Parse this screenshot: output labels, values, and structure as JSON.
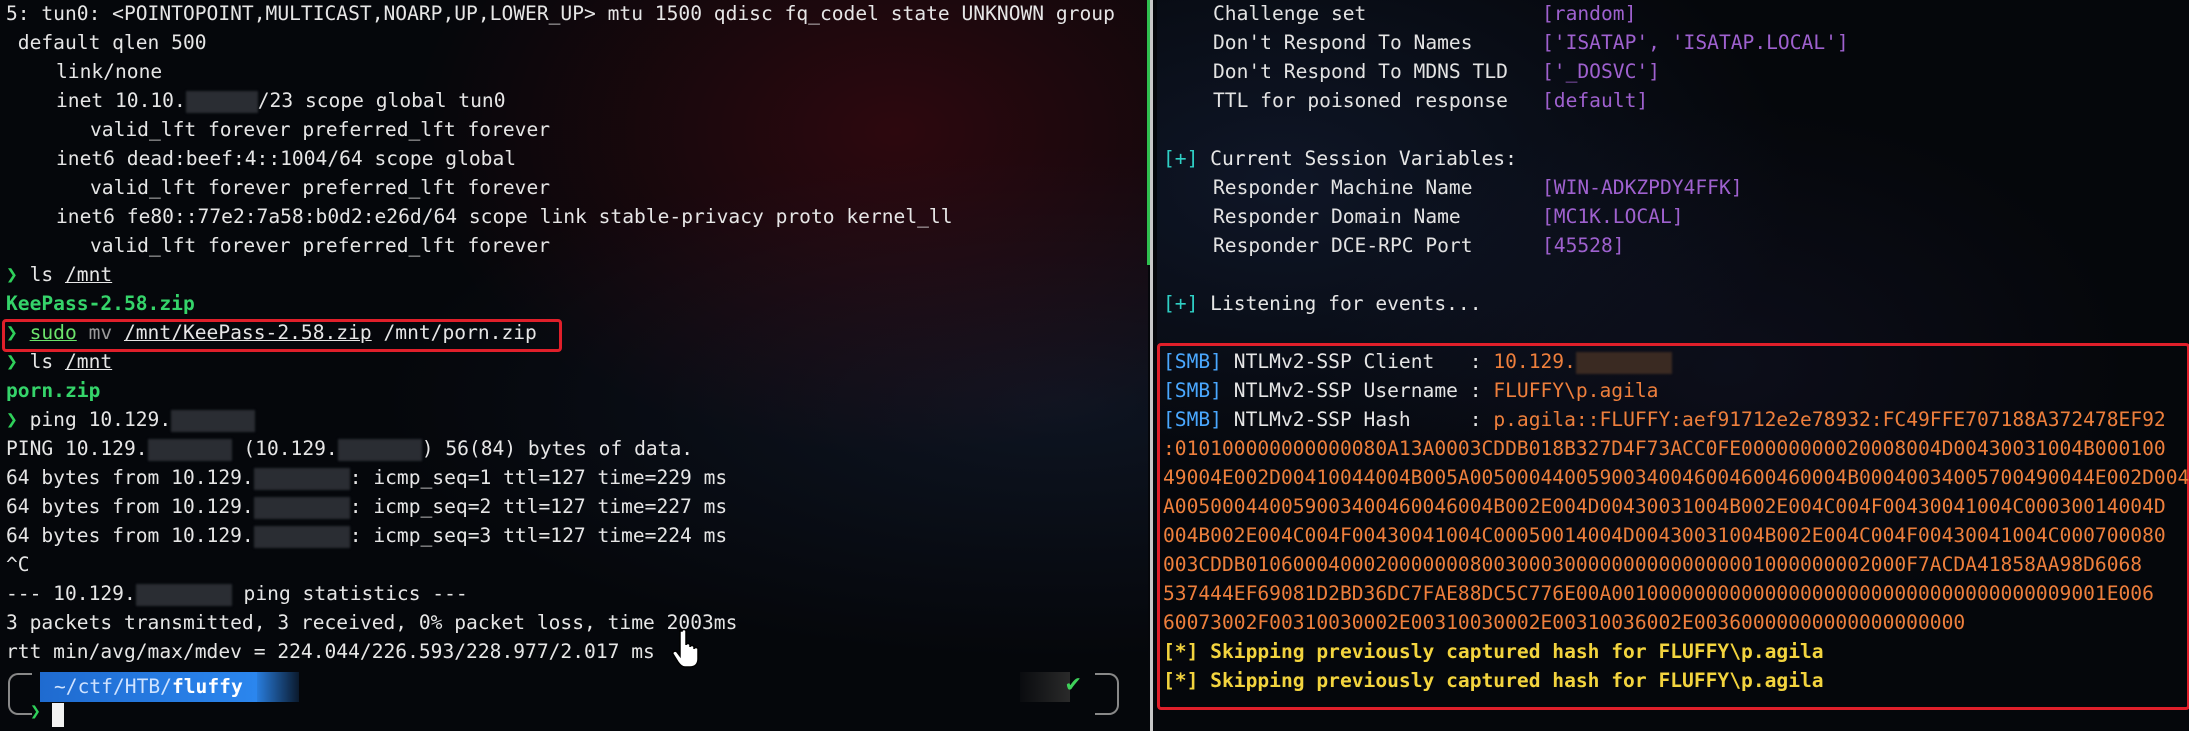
{
  "left_terminal": {
    "lines": {
      "l1": "5: tun0: <POINTOPOINT,MULTICAST,NOARP,UP,LOWER_UP> mtu 1500 qdisc fq_codel state UNKNOWN group",
      "l2": " default qlen 500",
      "l3": "link/none",
      "l4a": "inet 10.10.",
      "l4b": "/23 scope global tun0",
      "l5": "valid_lft forever preferred_lft forever",
      "l6": "inet6 dead:beef:4::1004/64 scope global",
      "l7": "valid_lft forever preferred_lft forever",
      "l8": "inet6 fe80::77e2:7a58:b0d2:e26d/64 scope link stable-privacy proto kernel_ll",
      "l9": "valid_lft forever preferred_lft forever"
    },
    "prompt_symbol": "❯",
    "cmd_ls1": {
      "cmd": "ls",
      "arg": "/mnt"
    },
    "out_ls1": "KeePass-2.58.zip",
    "cmd_mv": {
      "sudo": "sudo",
      "mv": "mv",
      "src": "/mnt/KeePass-2.58.zip",
      "dst": "/mnt/porn.zip"
    },
    "cmd_ls2": {
      "cmd": "ls",
      "arg": "/mnt"
    },
    "out_ls2": "porn.zip",
    "cmd_ping": {
      "cmd": "ping",
      "arg": "10.129."
    },
    "ping_out": {
      "header_a": "PING 10.129.",
      "header_b": " (10.129.",
      "header_c": ") 56(84) bytes of data.",
      "r1a": "64 bytes from 10.129.",
      "r1b": ": icmp_seq=1 ttl=127 time=229 ms",
      "r2a": "64 bytes from 10.129.",
      "r2b": ": icmp_seq=2 ttl=127 time=227 ms",
      "r3a": "64 bytes from 10.129.",
      "r3b": ": icmp_seq=3 ttl=127 time=224 ms",
      "ctrl_c": "^C",
      "stats_a": "--- 10.129.",
      "stats_b": " ping statistics ---",
      "summary": "3 packets transmitted, 3 received, 0% packet loss, time 2003ms",
      "rtt": "rtt min/avg/max/mdev = 224.044/226.593/228.977/2.017 ms"
    },
    "statusbar": {
      "path_prefix": "~/ctf/HTB/",
      "path_dir": "fluffy",
      "status_check": "✔",
      "input_arrow": "❯"
    }
  },
  "right_terminal": {
    "settings": [
      {
        "label": "Challenge set",
        "value": "[random]"
      },
      {
        "label": "Don't Respond To Names",
        "value": "['ISATAP', 'ISATAP.LOCAL']"
      },
      {
        "label": "Don't Respond To MDNS TLD",
        "value": "['_DOSVC']"
      },
      {
        "label": "TTL for poisoned response",
        "value": "[default]"
      }
    ],
    "session_header_marker": "[+]",
    "session_header": " Current Session Variables:",
    "session": [
      {
        "label": "Responder Machine Name",
        "value": "[WIN-ADKZPDY4FFK]"
      },
      {
        "label": "Responder Domain Name",
        "value": "[MC1K.LOCAL]"
      },
      {
        "label": "Responder DCE-RPC Port",
        "value": "[45528]"
      }
    ],
    "listening_marker": "[+]",
    "listening": " Listening for events...",
    "capture": {
      "tag": "[SMB]",
      "client_label": " NTLMv2-SSP Client   : ",
      "client_value": "10.129.",
      "username_label": " NTLMv2-SSP Username : ",
      "username_value": "FLUFFY\\p.agila",
      "hash_label": " NTLMv2-SSP Hash     : ",
      "hash_lines": [
        "p.agila::FLUFFY:aef91712e2e78932:FC49FFE707188A372478EF92",
        ":010100000000000080A13A0003CDDB018B327D4F73ACC0FE00000000020008004D00430031004B000100",
        "49004E002D00410044004B005A00500044005900340046004600460004B00040034005700490044E002D0041004",
        "A005000440059003400460046004B002E004D00430031004B002E004C004F00430041004C00030014004D",
        "004B002E004C004F00430041004C00050014004D00430031004B002E004C004F00430041004C000700080",
        "003CDDB01060004000200000008003000300000000000000001000000002000F7ACDA41858AA98D6068",
        "537444EF69081D2BD36DC7FAE88DC5C776E00A001000000000000000000000000000000000009001E006",
        "60073002F00310030002E00310030002E00310036002E00360000000000000000000"
      ]
    },
    "skip_lines": [
      "[*] Skipping previously captured hash for FLUFFY\\p.agila",
      "[*] Skipping previously captured hash for FLUFFY\\p.agila"
    ]
  }
}
